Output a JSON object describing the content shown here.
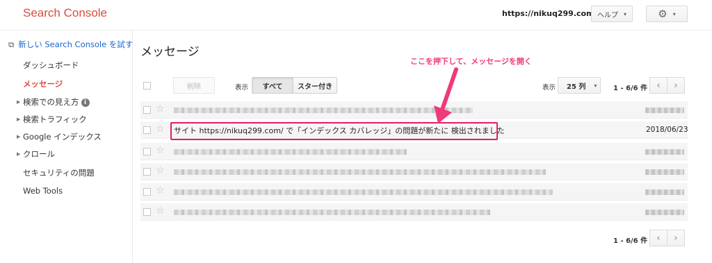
{
  "header": {
    "logo": "Search Console",
    "site_url": "https://nikuq299.com/",
    "help_label": "ヘルプ",
    "help_caret": "▾",
    "settings_caret": "▾",
    "settings_icon": "⚙"
  },
  "sidebar": {
    "new_console": "新しい Search Console を試す",
    "new_console_icon": "⧉",
    "items": [
      {
        "label": "ダッシュボード",
        "expandable": false
      },
      {
        "label": "メッセージ",
        "expandable": false,
        "active": true
      },
      {
        "label": "検索での見え方",
        "expandable": true,
        "info_icon": "i"
      },
      {
        "label": "検索トラフィック",
        "expandable": true
      },
      {
        "label": "Google インデックス",
        "expandable": true
      },
      {
        "label": "クロール",
        "expandable": true
      },
      {
        "label": "セキュリティの問題",
        "expandable": false
      },
      {
        "label": "Web Tools",
        "expandable": false
      }
    ],
    "expand_glyph": "▶"
  },
  "main": {
    "title": "メッセージ",
    "annotation": "ここを押下して、メッセージを開く",
    "toolbar": {
      "delete_label": "削除",
      "show_label": "表示",
      "filter_all": "すべて",
      "filter_starred": "スター付き",
      "rows_show_label": "表示",
      "rows_value": "25 列",
      "rows_caret": "▾",
      "pager_text": "1 - 6/6 件",
      "prev_glyph": "‹",
      "next_glyph": "›"
    },
    "messages": [
      {
        "subject": "",
        "date": "",
        "redacted": true
      },
      {
        "subject": "サイト https://nikuq299.com/ で「インデックス カバレッジ」の問題が新たに 検出されました",
        "date": "2018/06/23",
        "redacted": false
      },
      {
        "subject": "",
        "date": "",
        "redacted": true
      },
      {
        "subject": "",
        "date": "",
        "redacted": true
      },
      {
        "subject": "",
        "date": "",
        "redacted": true
      },
      {
        "subject": "",
        "date": "",
        "redacted": true
      }
    ],
    "star_glyph": "☆",
    "footer_pager_text": "1 - 6/6 件",
    "highlight_color": "#e8186c",
    "accent_color": "#dd4b39"
  }
}
